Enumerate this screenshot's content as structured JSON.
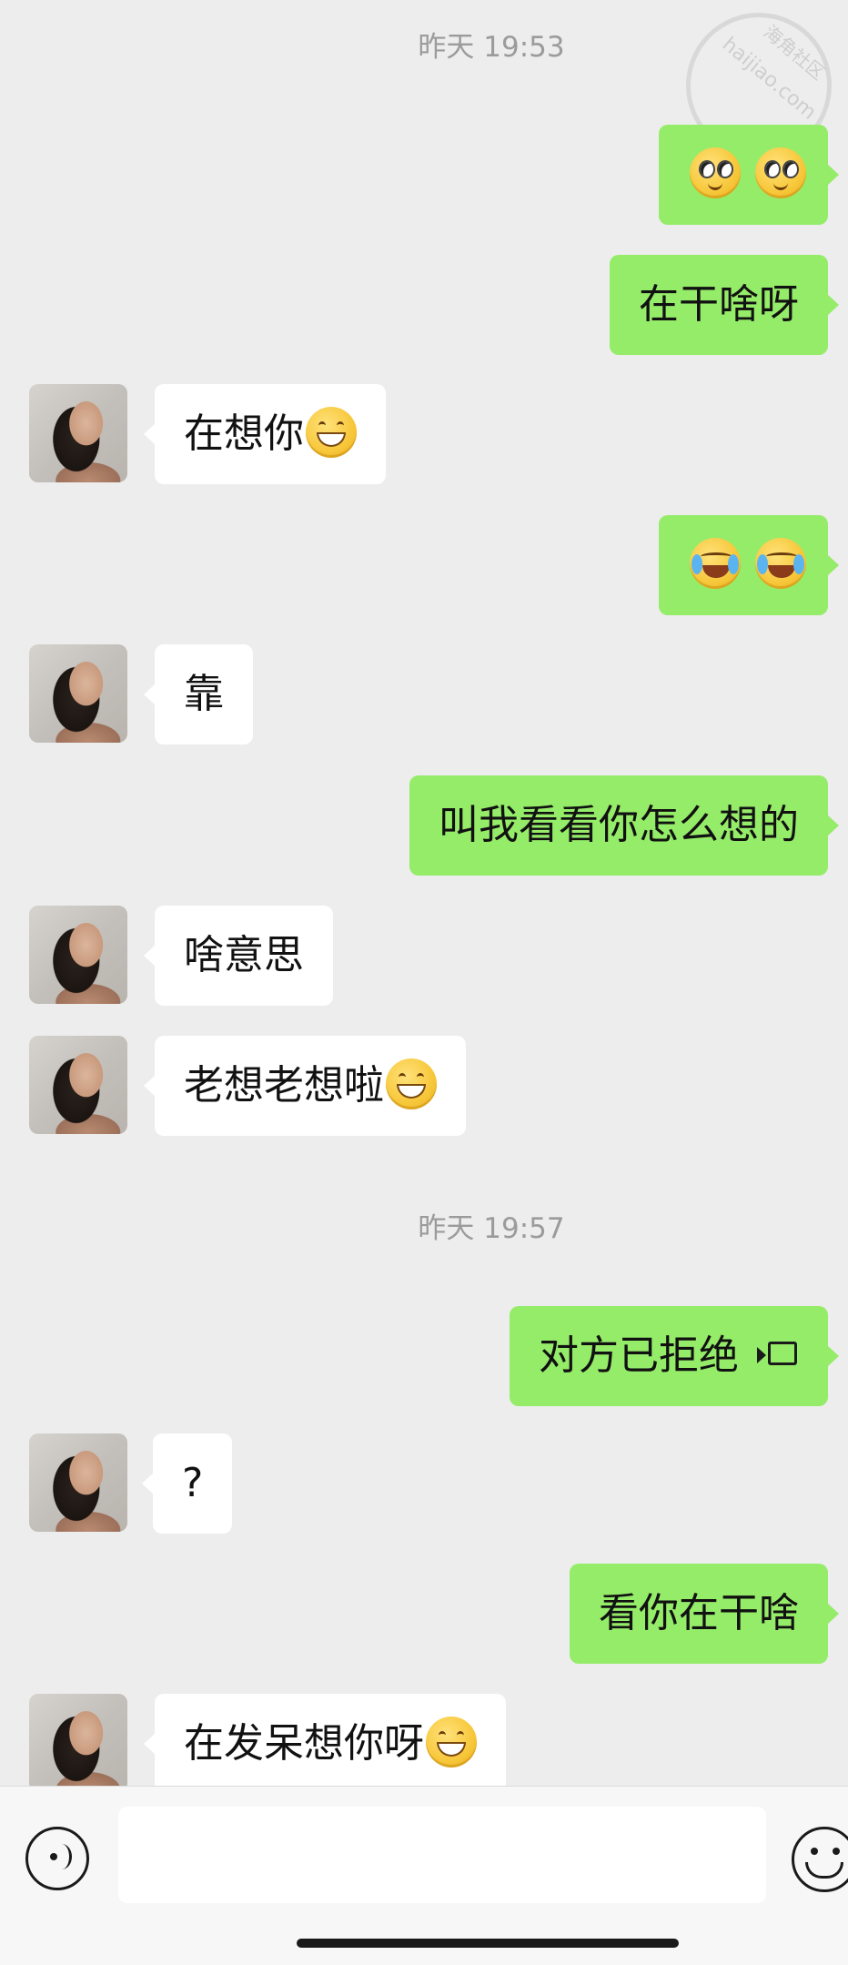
{
  "timestamps": [
    "昨天 19:53",
    "昨天 19:57"
  ],
  "messages": [
    {
      "side": "out",
      "text": "",
      "emoji": [
        "eyes",
        "eyes"
      ]
    },
    {
      "side": "out",
      "text": "在干啥呀"
    },
    {
      "side": "in",
      "text": "在想你",
      "emoji": [
        "grin"
      ]
    },
    {
      "side": "out",
      "text": "",
      "emoji": [
        "cry",
        "cry"
      ]
    },
    {
      "side": "in",
      "text": "靠"
    },
    {
      "side": "out",
      "text": "叫我看看你怎么想的"
    },
    {
      "side": "in",
      "text": "啥意思"
    },
    {
      "side": "in",
      "text": "老想老想啦",
      "emoji": [
        "grin"
      ]
    },
    {
      "side": "out",
      "text": "对方已拒绝",
      "icon": "video-call-icon"
    },
    {
      "side": "in",
      "text": "?"
    },
    {
      "side": "out",
      "text": "看你在干啥"
    },
    {
      "side": "in",
      "text": "在发呆想你呀",
      "emoji": [
        "grin"
      ]
    }
  ],
  "watermark": {
    "text": "haijiao.com",
    "cn": "海角社区"
  },
  "input": {
    "value": "",
    "placeholder": ""
  },
  "icons": {
    "voice": "voice-mode-icon",
    "emoji": "emoji-picker-icon",
    "emoji_eyes": "rolling-eyes-emoji-icon",
    "emoji_grin": "grinning-emoji-icon",
    "emoji_cry": "crying-laughing-emoji-icon"
  },
  "colors": {
    "background": "#ededed",
    "outgoing_bubble": "#95ec69",
    "incoming_bubble": "#ffffff",
    "timestamp": "#9b9b9b"
  }
}
